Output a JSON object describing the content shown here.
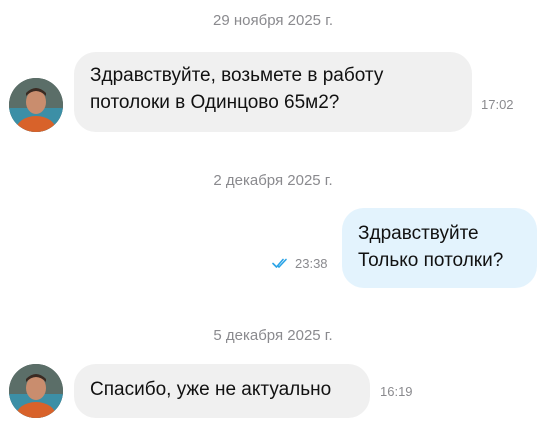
{
  "messages_thread": [
    {
      "date": "29 ноября 2025 г.",
      "message": {
        "direction": "incoming",
        "lines": [
          "Здравствуйте, возьмете в работу",
          "потолоки в Одинцово 65м2?"
        ],
        "time": "17:02"
      }
    },
    {
      "date": "2 декабря 2025 г.",
      "message": {
        "direction": "outgoing",
        "lines": [
          "Здравствуйте",
          "Только потолки?"
        ],
        "time": "23:38",
        "status_icon": "double-check-icon"
      }
    },
    {
      "date": "5 декабря 2025 г.",
      "message": {
        "direction": "incoming",
        "lines": [
          "Спасибо, уже не актуально"
        ],
        "time": "16:19"
      }
    }
  ],
  "colors": {
    "incoming_bubble": "#f0f0f0",
    "outgoing_bubble": "#e3f3fd",
    "meta_text": "#8a8a8e",
    "read_check": "#2aa3e6"
  }
}
